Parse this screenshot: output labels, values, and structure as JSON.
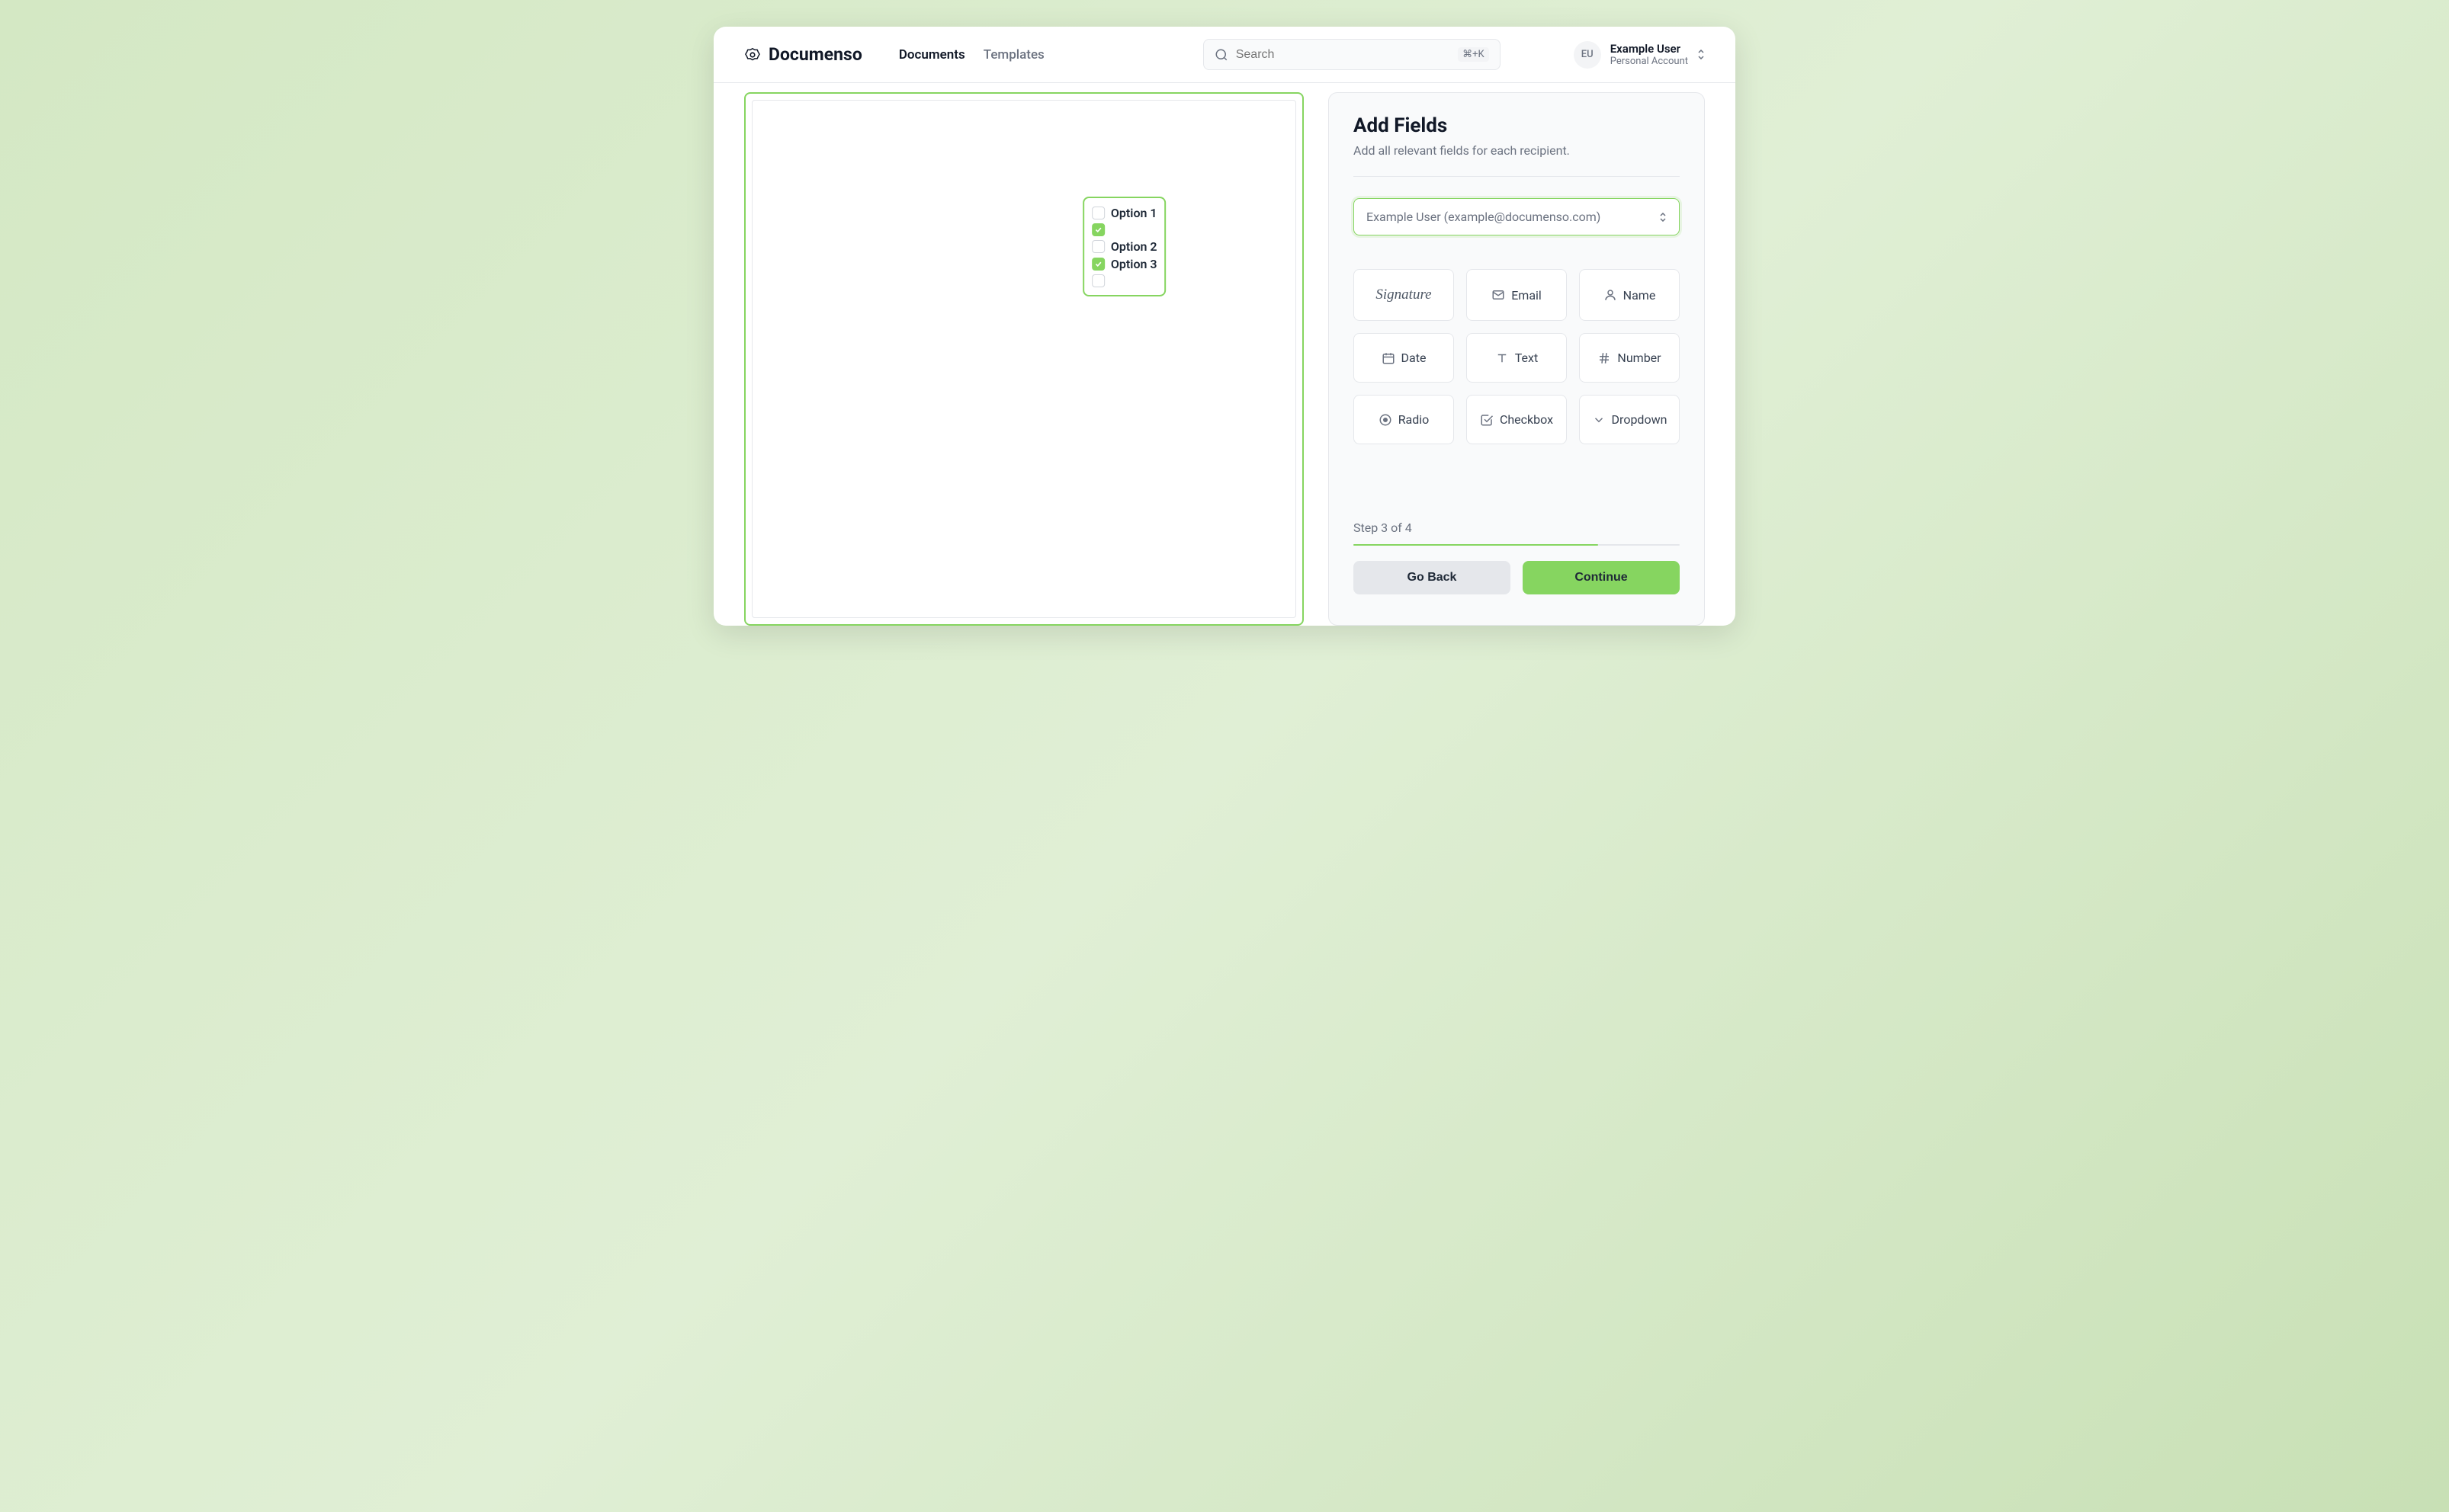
{
  "brand": {
    "name": "Documenso"
  },
  "nav": {
    "documents": "Documents",
    "templates": "Templates"
  },
  "search": {
    "placeholder": "Search",
    "shortcut": "⌘+K"
  },
  "user": {
    "initials": "EU",
    "name": "Example User",
    "account": "Personal Account"
  },
  "document": {
    "widget": {
      "options": {
        "opt1": "Option 1",
        "opt2": "Option 2",
        "opt3": "Option 3"
      }
    }
  },
  "sidebar": {
    "title": "Add Fields",
    "subtitle": "Add all relevant fields for each recipient.",
    "recipient": "Example User (example@documenso.com)",
    "fields": {
      "signature": "Signature",
      "email": "Email",
      "name": "Name",
      "date": "Date",
      "text": "Text",
      "number": "Number",
      "radio": "Radio",
      "checkbox": "Checkbox",
      "dropdown": "Dropdown"
    },
    "step": "Step 3 of 4",
    "back_label": "Go Back",
    "continue_label": "Continue"
  }
}
